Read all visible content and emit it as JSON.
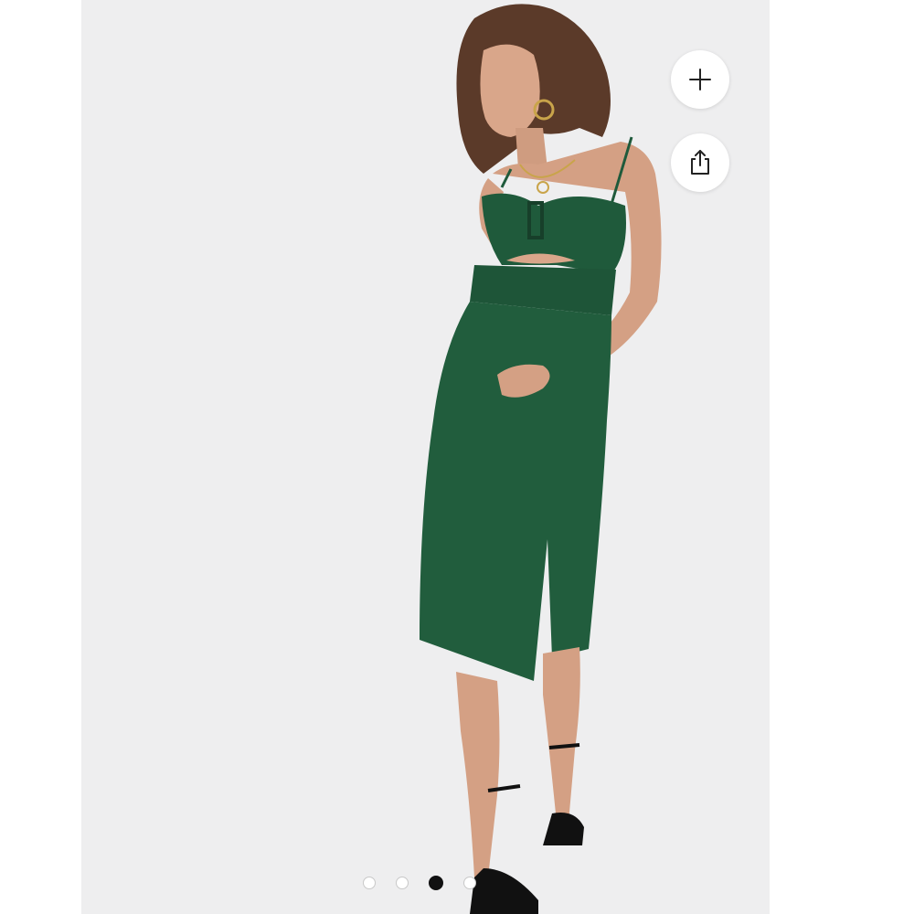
{
  "product_image": {
    "subject": "model-in-green-midi-dress",
    "background_color": "#eeeeef",
    "dress_color": "#1f5a3b"
  },
  "actions": {
    "add_icon": "plus-icon",
    "share_icon": "share-icon"
  },
  "carousel": {
    "total": 4,
    "active_index": 2
  },
  "colors": {
    "fab_bg": "#ffffff",
    "dot_active": "#111111",
    "dot_inactive_border": "#c8c8c8"
  }
}
